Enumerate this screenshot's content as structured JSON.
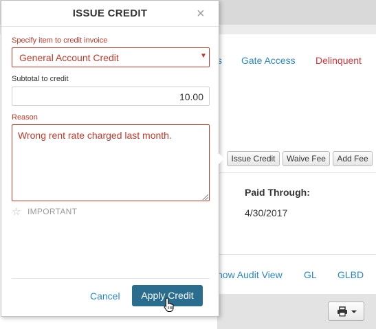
{
  "background": {
    "tabs": {
      "partial": "s",
      "gate_access": "Gate Access",
      "delinquent": "Delinquent"
    },
    "actions": {
      "issue_credit": "Issue Credit",
      "waive_fee": "Waive Fee",
      "add_fee": "Add Fee"
    },
    "paid_through": {
      "label": "Paid Through:",
      "value": "4/30/2017"
    },
    "links": {
      "audit_view": "how Audit View",
      "gl": "GL",
      "glbd": "GLBD"
    },
    "print_icon": "printer-icon"
  },
  "modal": {
    "title": "ISSUE CREDIT",
    "close_glyph": "×",
    "item_label": "Specify item to credit invoice",
    "item_value": "General Account Credit",
    "subtotal_label": "Subtotal to credit",
    "subtotal_value": "10.00",
    "reason_label": "Reason",
    "reason_value": "Wrong rent rate charged last month.",
    "important_label": "IMPORTANT",
    "cancel_label": "Cancel",
    "apply_label": "Apply Credit"
  },
  "colors": {
    "error_red": "#c0392b",
    "link_blue": "#2a86c8",
    "primary_button": "#2a6d8f"
  }
}
